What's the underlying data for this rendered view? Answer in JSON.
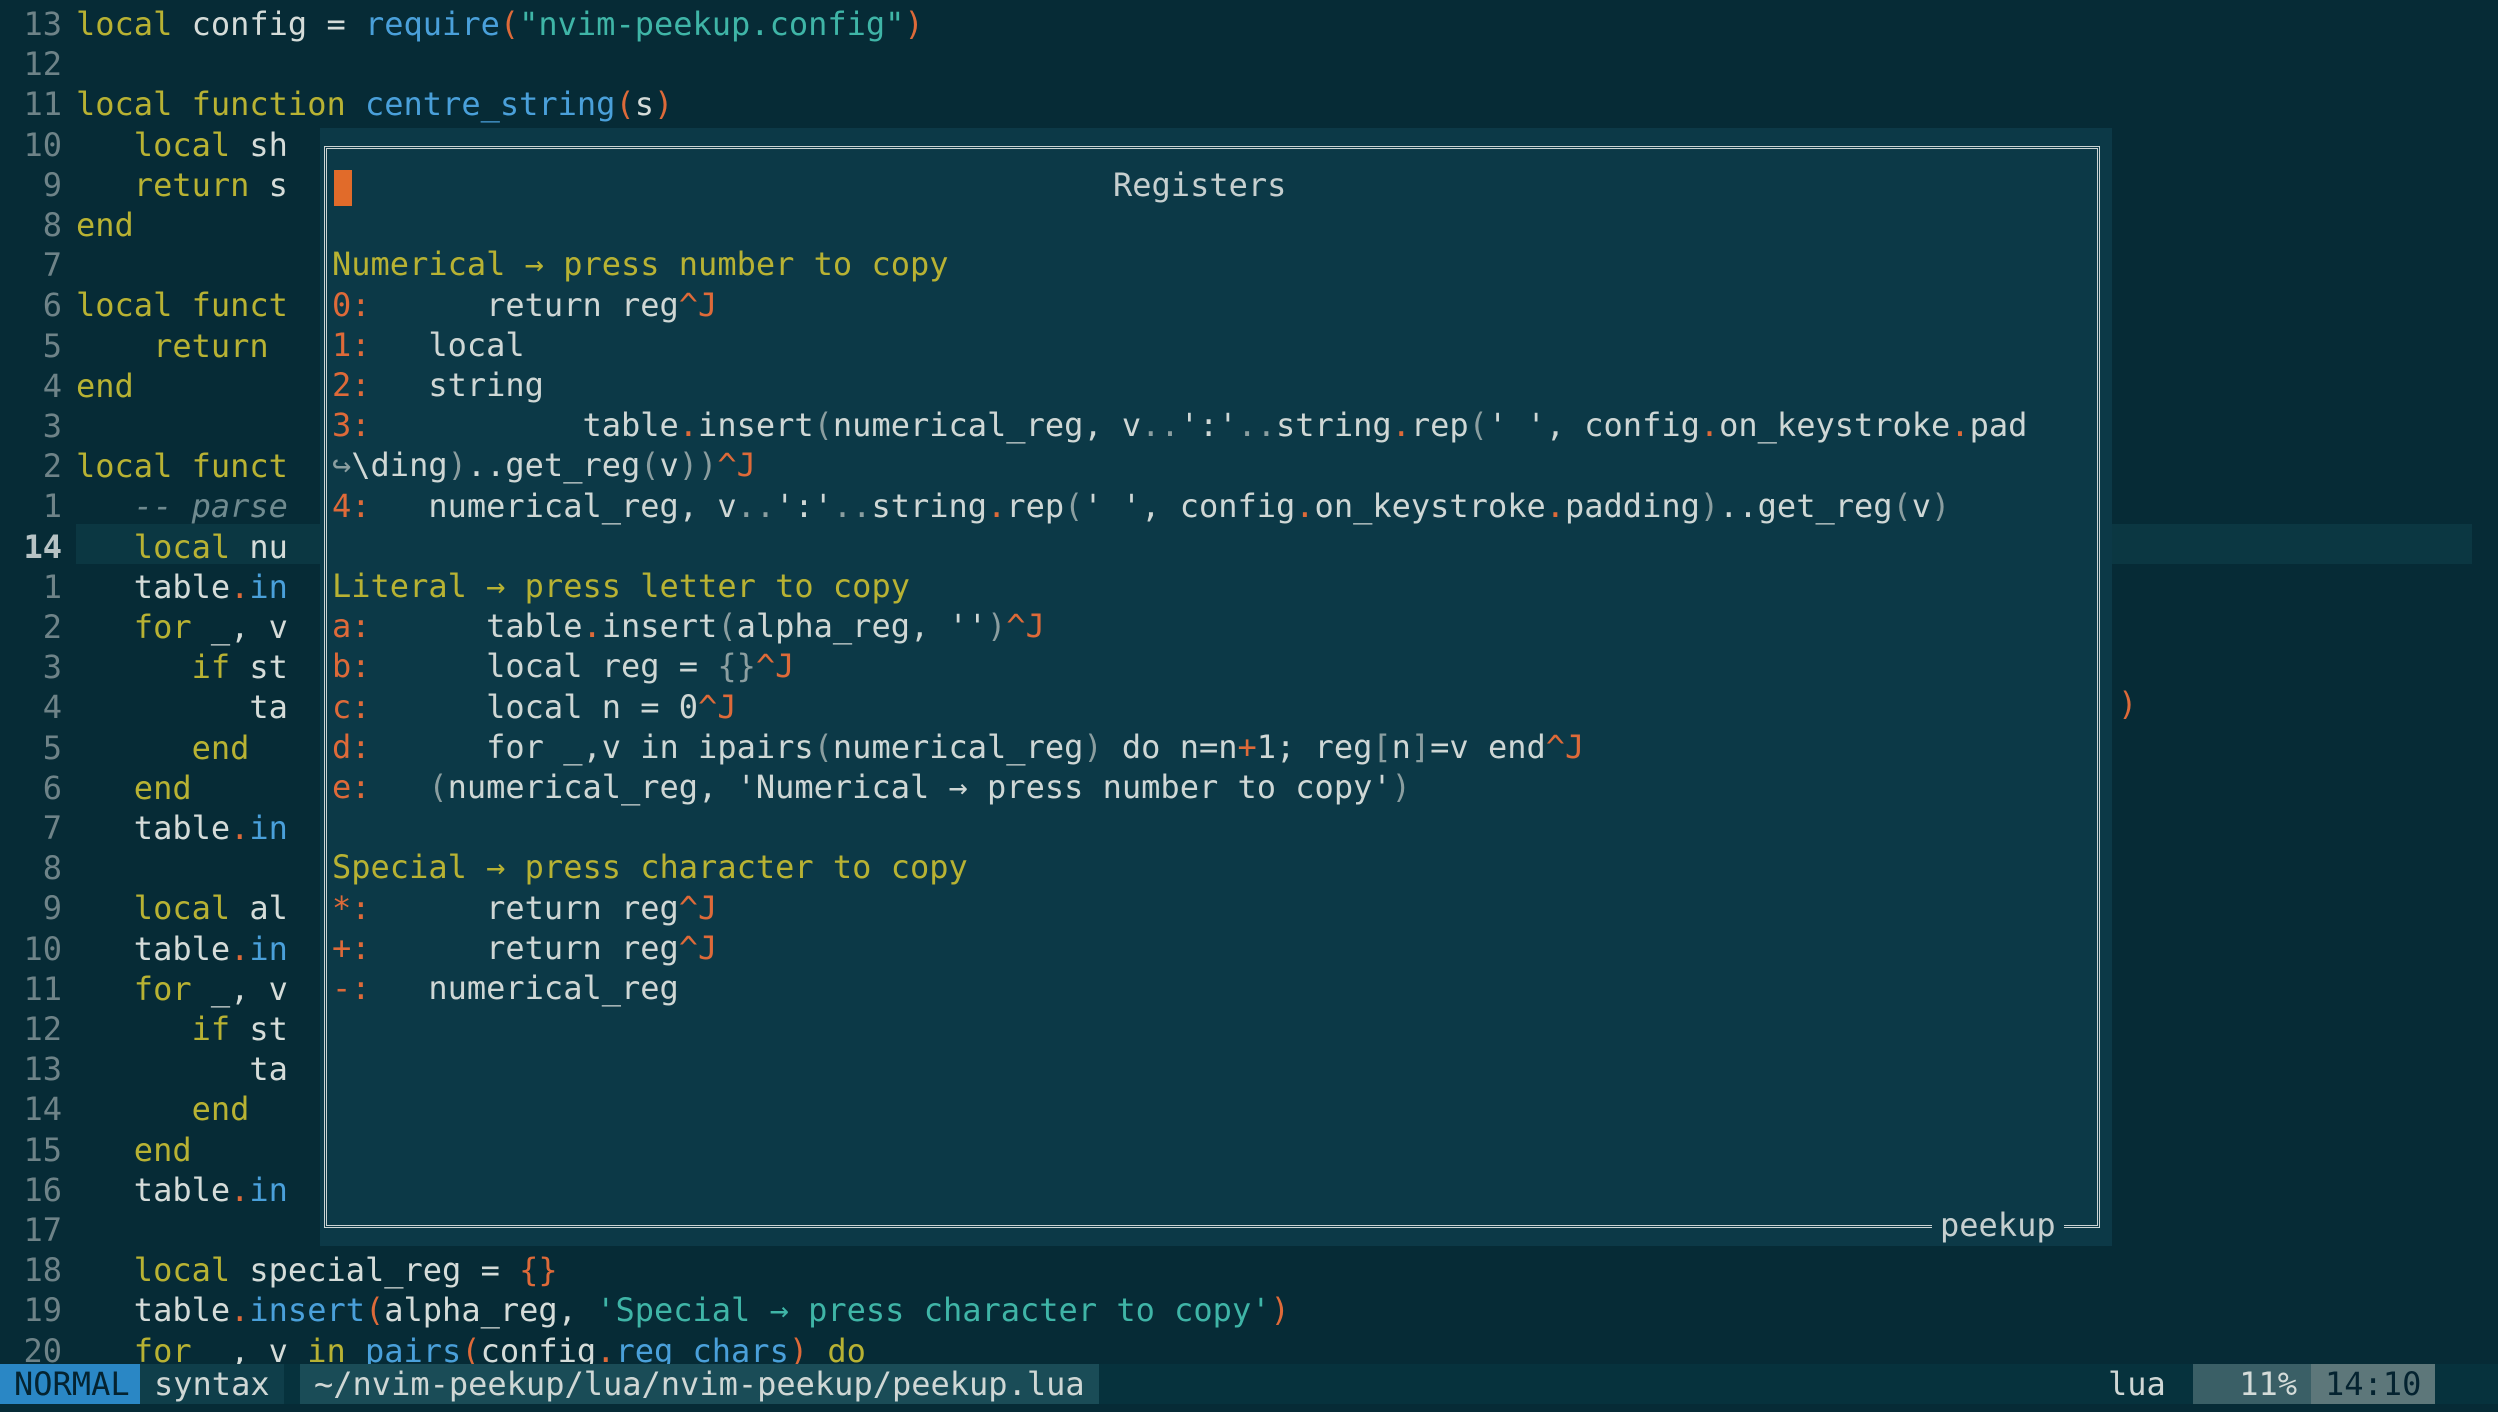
{
  "editor_lines": [
    {
      "num": "13",
      "segs": [
        [
          "kw",
          "local "
        ],
        [
          "code",
          "config = "
        ],
        [
          "fn",
          "require"
        ],
        [
          "pn",
          "("
        ],
        [
          "str",
          "\"nvim-peekup.config\""
        ],
        [
          "pn",
          ")"
        ]
      ]
    },
    {
      "num": "12",
      "segs": []
    },
    {
      "num": "11",
      "segs": [
        [
          "kw",
          "local function "
        ],
        [
          "fn",
          "centre_string"
        ],
        [
          "pn",
          "("
        ],
        [
          "code",
          "s"
        ],
        [
          "pn",
          ")"
        ]
      ]
    },
    {
      "num": "10",
      "segs": [
        [
          "kw",
          "   local "
        ],
        [
          "code",
          "sh"
        ]
      ]
    },
    {
      "num": "9",
      "segs": [
        [
          "kw",
          "   return "
        ],
        [
          "code",
          "s"
        ]
      ]
    },
    {
      "num": "8",
      "segs": [
        [
          "kw",
          "end"
        ]
      ]
    },
    {
      "num": "7",
      "segs": []
    },
    {
      "num": "6",
      "segs": [
        [
          "kw",
          "local funct"
        ]
      ]
    },
    {
      "num": "5",
      "segs": [
        [
          "kw",
          "    return "
        ]
      ]
    },
    {
      "num": "4",
      "segs": [
        [
          "kw",
          "end"
        ]
      ]
    },
    {
      "num": "3",
      "segs": []
    },
    {
      "num": "2",
      "segs": [
        [
          "kw",
          "local funct"
        ]
      ]
    },
    {
      "num": "1",
      "segs": [
        [
          "cm",
          "   -- parse"
        ]
      ]
    },
    {
      "num": "14",
      "cur": true,
      "segs": [
        [
          "kw",
          "   local "
        ],
        [
          "code",
          "nu"
        ]
      ]
    },
    {
      "num": "1",
      "segs": [
        [
          "code",
          "   table"
        ],
        [
          "pn",
          "."
        ],
        [
          "fn",
          "in"
        ]
      ]
    },
    {
      "num": "2",
      "segs": [
        [
          "kw",
          "   for "
        ],
        [
          "code",
          "_, v"
        ]
      ]
    },
    {
      "num": "3",
      "segs": [
        [
          "kw",
          "      if "
        ],
        [
          "code",
          "st"
        ]
      ]
    },
    {
      "num": "4",
      "segs": [
        [
          "code",
          "         ta"
        ]
      ]
    },
    {
      "num": "5",
      "segs": [
        [
          "kw",
          "      end"
        ]
      ]
    },
    {
      "num": "6",
      "segs": [
        [
          "kw",
          "   end"
        ]
      ]
    },
    {
      "num": "7",
      "segs": [
        [
          "code",
          "   table"
        ],
        [
          "pn",
          "."
        ],
        [
          "fn",
          "in"
        ]
      ]
    },
    {
      "num": "8",
      "segs": []
    },
    {
      "num": "9",
      "segs": [
        [
          "kw",
          "   local "
        ],
        [
          "code",
          "al"
        ]
      ]
    },
    {
      "num": "10",
      "segs": [
        [
          "code",
          "   table"
        ],
        [
          "pn",
          "."
        ],
        [
          "fn",
          "in"
        ]
      ]
    },
    {
      "num": "11",
      "segs": [
        [
          "kw",
          "   for "
        ],
        [
          "code",
          "_, v"
        ]
      ]
    },
    {
      "num": "12",
      "segs": [
        [
          "kw",
          "      if "
        ],
        [
          "code",
          "st"
        ]
      ]
    },
    {
      "num": "13",
      "segs": [
        [
          "code",
          "         ta"
        ]
      ]
    },
    {
      "num": "14",
      "segs": [
        [
          "kw",
          "      end"
        ]
      ]
    },
    {
      "num": "15",
      "segs": [
        [
          "kw",
          "   end"
        ]
      ]
    },
    {
      "num": "16",
      "segs": [
        [
          "code",
          "   table"
        ],
        [
          "pn",
          "."
        ],
        [
          "fn",
          "in"
        ]
      ]
    },
    {
      "num": "17",
      "segs": []
    },
    {
      "num": "18",
      "segs": [
        [
          "kw",
          "   local "
        ],
        [
          "code",
          "special_reg = "
        ],
        [
          "pn",
          "{}"
        ]
      ]
    },
    {
      "num": "19",
      "segs": [
        [
          "code",
          "   table"
        ],
        [
          "pn",
          "."
        ],
        [
          "fn",
          "insert"
        ],
        [
          "pn",
          "("
        ],
        [
          "code",
          "alpha_reg, "
        ],
        [
          "str",
          "'Special → press character to copy'"
        ],
        [
          "pn",
          ")"
        ]
      ]
    },
    {
      "num": "20",
      "segs": [
        [
          "kw",
          "   for "
        ],
        [
          "code",
          "_, v "
        ],
        [
          "kw",
          "in "
        ],
        [
          "fn",
          "pairs"
        ],
        [
          "pn",
          "("
        ],
        [
          "code",
          "config"
        ],
        [
          "pn",
          "."
        ],
        [
          "fn",
          "reg_chars"
        ],
        [
          "pn",
          ") "
        ],
        [
          "kw",
          "do"
        ]
      ]
    }
  ],
  "right_overflow_paren": ")",
  "peekup": {
    "title": "Registers",
    "footer": "peekup",
    "lines": [
      [],
      [],
      [
        [
          "hdr",
          "Numerical → press number to copy"
        ]
      ],
      [
        [
          "rk",
          "0:"
        ],
        [
          "val",
          "      return reg"
        ],
        [
          "rk",
          "^J"
        ]
      ],
      [
        [
          "rk",
          "1:"
        ],
        [
          "val",
          "   local"
        ]
      ],
      [
        [
          "rk",
          "2:"
        ],
        [
          "val",
          "   string"
        ]
      ],
      [
        [
          "rk",
          "3:"
        ],
        [
          "val",
          "           table"
        ],
        [
          "rk",
          "."
        ],
        [
          "val",
          "insert"
        ],
        [
          "dim",
          "("
        ],
        [
          "val",
          "numerical_reg, v"
        ],
        [
          "dim",
          ".."
        ],
        [
          "val",
          "':'"
        ],
        [
          "dim",
          ".."
        ],
        [
          "val",
          "string"
        ],
        [
          "rk",
          "."
        ],
        [
          "val",
          "rep"
        ],
        [
          "dim",
          "("
        ],
        [
          "val",
          "' ', config"
        ],
        [
          "rk",
          "."
        ],
        [
          "val",
          "on_keystroke"
        ],
        [
          "rk",
          "."
        ],
        [
          "val",
          "pad"
        ]
      ],
      [
        [
          "dim",
          "↪"
        ],
        [
          "val",
          "\\ding"
        ],
        [
          "dim",
          ")"
        ],
        [
          "val",
          ".."
        ],
        [
          "val",
          "get_reg"
        ],
        [
          "dim",
          "("
        ],
        [
          "val",
          "v"
        ],
        [
          "dim",
          "))"
        ],
        [
          "rk",
          "^J"
        ]
      ],
      [
        [
          "rk",
          "4:"
        ],
        [
          "val",
          "   numerical_reg, v"
        ],
        [
          "dim",
          ".."
        ],
        [
          "val",
          "':'"
        ],
        [
          "dim",
          ".."
        ],
        [
          "val",
          "string"
        ],
        [
          "rk",
          "."
        ],
        [
          "val",
          "rep"
        ],
        [
          "dim",
          "("
        ],
        [
          "val",
          "' ', config"
        ],
        [
          "rk",
          "."
        ],
        [
          "val",
          "on_keystroke"
        ],
        [
          "rk",
          "."
        ],
        [
          "val",
          "padding"
        ],
        [
          "dim",
          ")"
        ],
        [
          "val",
          ".."
        ],
        [
          "val",
          "get_reg"
        ],
        [
          "dim",
          "("
        ],
        [
          "val",
          "v"
        ],
        [
          "dim",
          ")"
        ]
      ],
      [],
      [
        [
          "hdr",
          "Literal → press letter to copy"
        ]
      ],
      [
        [
          "rk",
          "a:"
        ],
        [
          "val",
          "      table"
        ],
        [
          "rk",
          "."
        ],
        [
          "val",
          "insert"
        ],
        [
          "dim",
          "("
        ],
        [
          "val",
          "alpha_reg, ''"
        ],
        [
          "dim",
          ")"
        ],
        [
          "rk",
          "^J"
        ]
      ],
      [
        [
          "rk",
          "b:"
        ],
        [
          "val",
          "      local reg = "
        ],
        [
          "dim",
          "{}"
        ],
        [
          "rk",
          "^J"
        ]
      ],
      [
        [
          "rk",
          "c:"
        ],
        [
          "val",
          "      local n = 0"
        ],
        [
          "rk",
          "^J"
        ]
      ],
      [
        [
          "rk",
          "d:"
        ],
        [
          "val",
          "      for _,v in ipairs"
        ],
        [
          "dim",
          "("
        ],
        [
          "val",
          "numerical_reg"
        ],
        [
          "dim",
          ")"
        ],
        [
          "val",
          " do n=n"
        ],
        [
          "rk",
          "+"
        ],
        [
          "val",
          "1; reg"
        ],
        [
          "dim",
          "["
        ],
        [
          "val",
          "n"
        ],
        [
          "dim",
          "]"
        ],
        [
          "val",
          "=v end"
        ],
        [
          "rk",
          "^J"
        ]
      ],
      [
        [
          "rk",
          "e:"
        ],
        [
          "val",
          "   "
        ],
        [
          "dim",
          "("
        ],
        [
          "val",
          "numerical_reg, 'Numerical → press number to copy'"
        ],
        [
          "dim",
          ")"
        ]
      ],
      [],
      [
        [
          "hdr",
          "Special → press character to copy"
        ]
      ],
      [
        [
          "rk",
          "*:"
        ],
        [
          "val",
          "      return reg"
        ],
        [
          "rk",
          "^J"
        ]
      ],
      [
        [
          "rk",
          "+:"
        ],
        [
          "val",
          "      return reg"
        ],
        [
          "rk",
          "^J"
        ]
      ],
      [
        [
          "rk",
          "-:"
        ],
        [
          "val",
          "   numerical_reg"
        ]
      ]
    ]
  },
  "statusline": {
    "mode": "NORMAL",
    "syntax": "syntax",
    "file": "~/nvim-peekup/lua/nvim-peekup/peekup.lua",
    "filetype": "lua",
    "percent": "11%",
    "position": "14:10"
  },
  "colors": {
    "background": "#062b36",
    "float_bg": "#0c3947",
    "keyword": "#b8b233",
    "function": "#4aa0da",
    "string": "#3fb5a7",
    "register_key": "#de6a39",
    "mode_bg": "#2a87c5"
  }
}
